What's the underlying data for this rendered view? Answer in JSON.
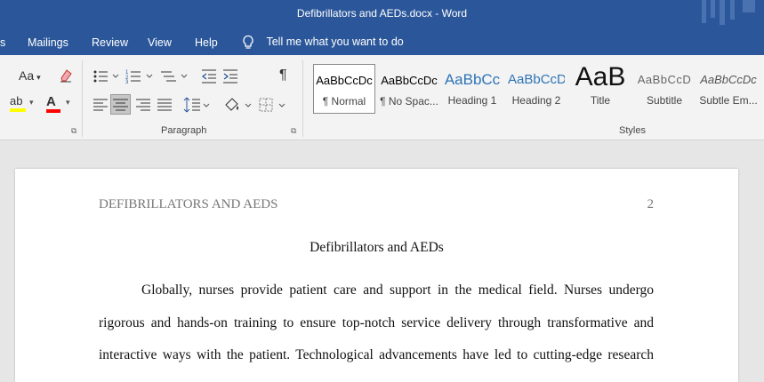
{
  "window": {
    "title": "Defibrillators and AEDs.docx  -  Word"
  },
  "tabs": [
    {
      "label": "s"
    },
    {
      "label": "Mailings"
    },
    {
      "label": "Review"
    },
    {
      "label": "View"
    },
    {
      "label": "Help"
    }
  ],
  "tell_me": {
    "label": "Tell me what you want to do",
    "icon": "lightbulb-icon"
  },
  "ribbon": {
    "font_group": {
      "change_case_label": "Aa",
      "font_color_label": "A",
      "highlight_label": "ab"
    },
    "paragraph_group": {
      "label": "Paragraph"
    },
    "styles_group": {
      "label": "Styles",
      "items": [
        {
          "sample": "AaBbCcDc",
          "name": "¶ Normal"
        },
        {
          "sample": "AaBbCcDc",
          "name": "¶ No Spac..."
        },
        {
          "sample": "AaBbCc",
          "name": "Heading 1"
        },
        {
          "sample": "AaBbCcD",
          "name": "Heading 2"
        },
        {
          "sample": "AaB",
          "name": "Title"
        },
        {
          "sample": "AaBbCcD",
          "name": "Subtitle"
        },
        {
          "sample": "AaBbCcDc",
          "name": "Subtle Em..."
        }
      ]
    }
  },
  "colors": {
    "accent": "#2b579a",
    "highlight": "#ffff00",
    "font_color": "#ff0000"
  },
  "document": {
    "header_title": "DEFIBRILLATORS AND AEDS",
    "page_number": "2",
    "title": "Defibrillators and AEDs",
    "lines": [
      "Globally, nurses provide patient care and support in the medical field. Nurses undergo",
      "rigorous and hands-on training to ensure top-notch service delivery through transformative and",
      "interactive ways with the patient. Technological advancements have led to cutting-edge research"
    ]
  }
}
